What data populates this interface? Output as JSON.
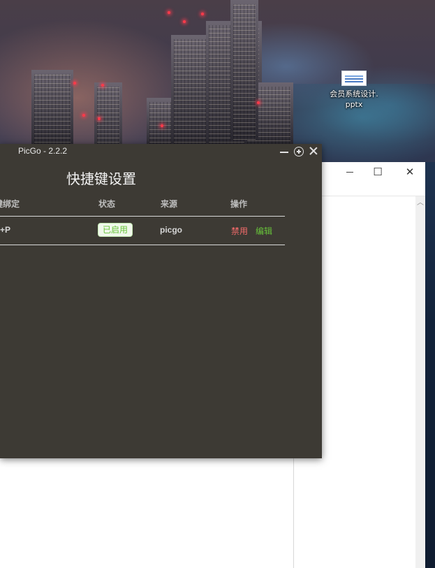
{
  "desktop": {
    "icon": {
      "label": "会员系统设计.pptx"
    }
  },
  "picgo": {
    "title": "PicGo - 2.2.2",
    "heading": "快捷键设置",
    "table": {
      "headers": [
        "键绑定",
        "状态",
        "来源",
        "操作"
      ],
      "rows": [
        {
          "binding": "+P",
          "status": "已启用",
          "source": "picgo",
          "actions": [
            "禁用",
            "编辑"
          ]
        }
      ]
    }
  },
  "colors": {
    "picgo_bg": "#3d3a34",
    "status_green": "#67c23a",
    "disable_red": "#f56c6c",
    "edit_green": "#67c23a"
  }
}
